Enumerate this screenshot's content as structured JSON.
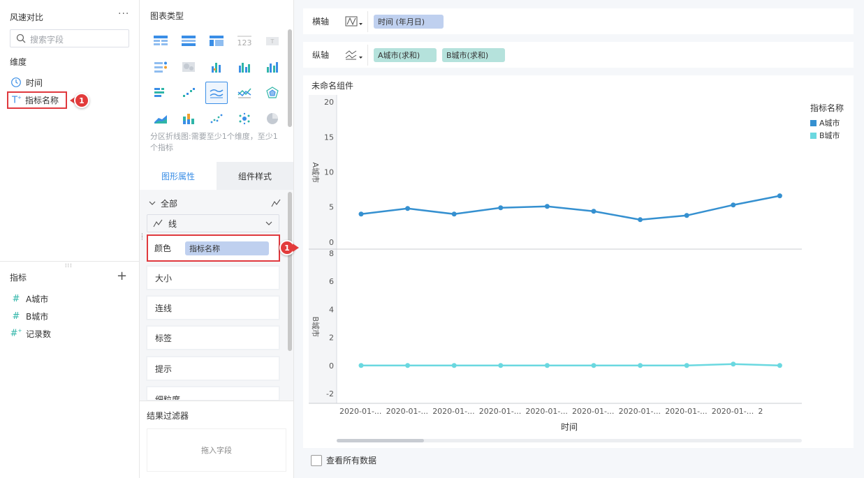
{
  "left_panel": {
    "title": "风速对比",
    "more": "···",
    "search_placeholder": "搜索字段",
    "dimensions_label": "维度",
    "dimensions": [
      {
        "label": "时间",
        "icon": "clock-icon"
      },
      {
        "label": "指标名称",
        "icon": "text-field-icon"
      }
    ],
    "metrics_label": "指标",
    "metrics": [
      {
        "label": "A城市",
        "icon": "hash-icon"
      },
      {
        "label": "B城市",
        "icon": "hash-icon"
      },
      {
        "label": "记录数",
        "icon": "hash-count-icon"
      }
    ]
  },
  "markers": {
    "first": "1",
    "second": "1"
  },
  "middle_panel": {
    "chart_type_title": "图表类型",
    "chart_description": "分区折线图:需要至少1个维度，至少1个指标",
    "tabs": [
      "图形属性",
      "组件样式"
    ],
    "all_label": "全部",
    "mark_type": "线",
    "color_label": "颜色",
    "color_field": "指标名称",
    "properties": [
      "大小",
      "连线",
      "标签",
      "提示",
      "细粒度"
    ],
    "filter_title": "结果过滤器",
    "drop_hint": "拖入字段"
  },
  "axes": {
    "x_label": "横轴",
    "x_field": "时间 (年月日)",
    "y_label": "纵轴",
    "y_fields": [
      "A城市(求和)",
      "B城市(求和)"
    ]
  },
  "component_title": "未命名组件",
  "legend": {
    "title": "指标名称",
    "items": [
      {
        "label": "A城市",
        "color": "#3590d0"
      },
      {
        "label": "B城市",
        "color": "#6ad8e0"
      }
    ]
  },
  "view_all_label": "查看所有数据",
  "colors": {
    "accent": "#3a8ee6",
    "highlight": "#e0393e",
    "series_a": "#3590d0",
    "series_b": "#6ad8e0"
  },
  "chart_data": {
    "type": "line",
    "xlabel": "时间",
    "x_tick_labels": [
      "2020-01-...",
      "2020-01-...",
      "2020-01-...",
      "2020-01-...",
      "2020-01-...",
      "2020-01-...",
      "2020-01-...",
      "2020-01-...",
      "2020-01-...",
      "2"
    ],
    "panels": [
      {
        "ylabel": "A城市",
        "yticks": [
          0,
          5,
          10,
          15,
          20
        ],
        "ylim": [
          -1,
          21
        ],
        "series": [
          {
            "name": "A城市",
            "values": [
              4,
              4.8,
              4,
              4.9,
              5.1,
              4.4,
              3.2,
              3.8,
              5.3,
              6.6
            ]
          }
        ]
      },
      {
        "ylabel": "B城市",
        "yticks": [
          -2,
          0,
          2,
          4,
          6,
          8
        ],
        "ylim": [
          -2.7,
          8.3
        ],
        "series": [
          {
            "name": "B城市",
            "values": [
              0,
              0,
              0,
              0,
              0,
              0,
              0,
              0,
              0.1,
              0
            ]
          }
        ]
      }
    ]
  }
}
